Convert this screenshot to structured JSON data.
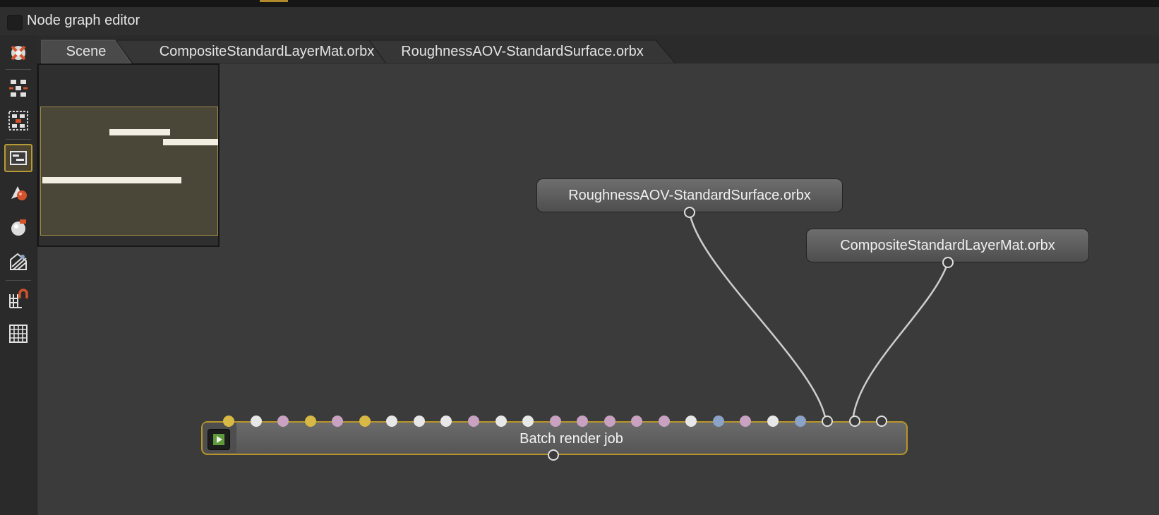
{
  "window": {
    "title": "Node graph editor"
  },
  "tabs": [
    {
      "label": "Scene",
      "active": true
    },
    {
      "label": "CompositeStandardLayerMat.orbx",
      "active": false
    },
    {
      "label": "RoughnessAOV-StandardSurface.orbx",
      "active": false
    }
  ],
  "toolbar": {
    "items": [
      {
        "name": "recenter-icon"
      },
      {
        "name": "arrange-nodes-icon"
      },
      {
        "name": "arrange-selected-icon"
      },
      {
        "name": "minimap-toggle-icon",
        "active": true
      },
      {
        "name": "load-material-icon"
      },
      {
        "name": "material-ball-icon"
      },
      {
        "name": "texture-icon"
      },
      {
        "name": "snap-magnet-icon"
      },
      {
        "name": "grid-icon"
      }
    ]
  },
  "nodes": {
    "roughness": {
      "label": "RoughnessAOV-StandardSurface.orbx"
    },
    "composite": {
      "label": "CompositeStandardLayerMat.orbx"
    },
    "batch": {
      "label": "Batch render job",
      "input_pin_colors": [
        "#d8b945",
        "#e8e8e8",
        "#c9a2c1",
        "#d8b945",
        "#c9a2c1",
        "#d8b945",
        "#e8e8e8",
        "#e8e8e8",
        "#e8e8e8",
        "#c9a2c1",
        "#e8e8e8",
        "#e8e8e8",
        "#c9a2c1",
        "#c9a2c1",
        "#c9a2c1",
        "#c9a2c1",
        "#c9a2c1",
        "#e8e8e8",
        "#8ba3c7",
        "#c9a2c1",
        "#e8e8e8",
        "#8ba3c7",
        "ring",
        "ring",
        "ring"
      ]
    }
  },
  "colors": {
    "selected_accent": "#b7952a",
    "canvas": "#3b3b3b",
    "wire": "#cfcfcf"
  }
}
